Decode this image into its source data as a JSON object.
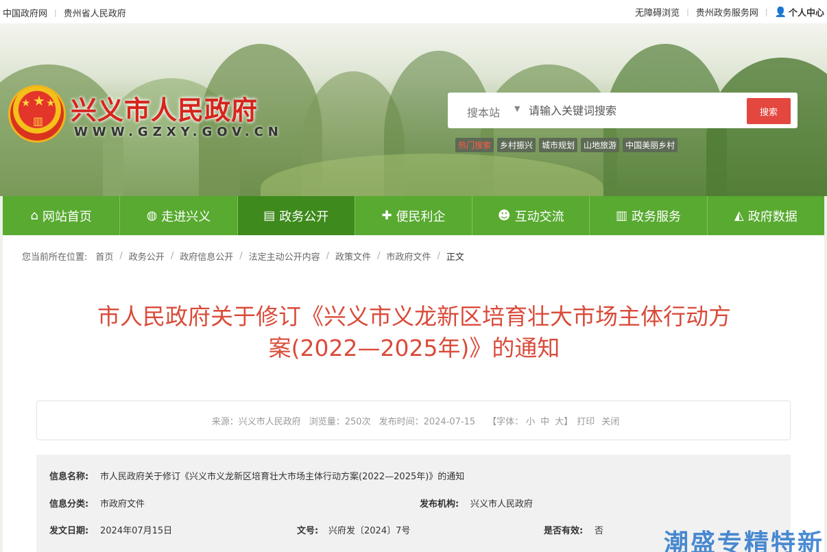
{
  "topbar": {
    "left": [
      "中国政府网",
      "贵州省人民政府"
    ],
    "right": [
      "无障碍浏览",
      "贵州政务服务网"
    ],
    "user": "个人中心"
  },
  "header": {
    "title": "兴义市人民政府",
    "url": "WWW.GZXY.GOV.CN"
  },
  "search": {
    "scope": "搜本站",
    "placeholder": "请输入关键词搜索",
    "button": "搜索"
  },
  "hotwords": [
    "热门搜索",
    "乡村振兴",
    "城市规划",
    "山地旅游",
    "中国美丽乡村"
  ],
  "nav": [
    {
      "label": "网站首页",
      "icon": "home-icon",
      "glyph": "⌂"
    },
    {
      "label": "走进兴义",
      "icon": "globe-icon",
      "glyph": "◍"
    },
    {
      "label": "政务公开",
      "icon": "document-icon",
      "glyph": "▤"
    },
    {
      "label": "便民利企",
      "icon": "puzzle-icon",
      "glyph": "✚"
    },
    {
      "label": "互动交流",
      "icon": "chat-icon",
      "glyph": "☻"
    },
    {
      "label": "政务服务",
      "icon": "building-icon",
      "glyph": "▥"
    },
    {
      "label": "政府数据",
      "icon": "chart-icon",
      "glyph": "◭"
    }
  ],
  "breadcrumb": {
    "prefix": "您当前所在位置:",
    "items": [
      "首页",
      "政务公开",
      "政府信息公开",
      "法定主动公开内容",
      "政策文件",
      "市政府文件"
    ],
    "current": "正文"
  },
  "article": {
    "title_line1": "市人民政府关于修订《兴义市义龙新区培育壮大市场主体行动方",
    "title_line2": "案(2022—2025年)》的通知"
  },
  "meta": {
    "source": "来源：兴义市人民政府",
    "views": "浏览量：250次",
    "published": "发布时间：2024-07-15",
    "font_label": "【字体：",
    "font_small": "小",
    "font_medium": "中",
    "font_large": "大",
    "font_end": "】",
    "print": "打印",
    "close": "关闭"
  },
  "info": {
    "name_label": "信息名称:",
    "name_value": "市人民政府关于修订《兴义市义龙新区培育壮大市场主体行动方案(2022—2025年)》的通知",
    "category_label": "信息分类:",
    "category_value": "市政府文件",
    "org_label": "发布机构:",
    "org_value": "兴义市人民政府",
    "date_label": "发文日期:",
    "date_value": "2024年07月15日",
    "docno_label": "文号:",
    "docno_value": "兴府发〔2024〕7号",
    "valid_label": "是否有效:",
    "valid_value": "否"
  },
  "watermark": "潮盛专精特新"
}
